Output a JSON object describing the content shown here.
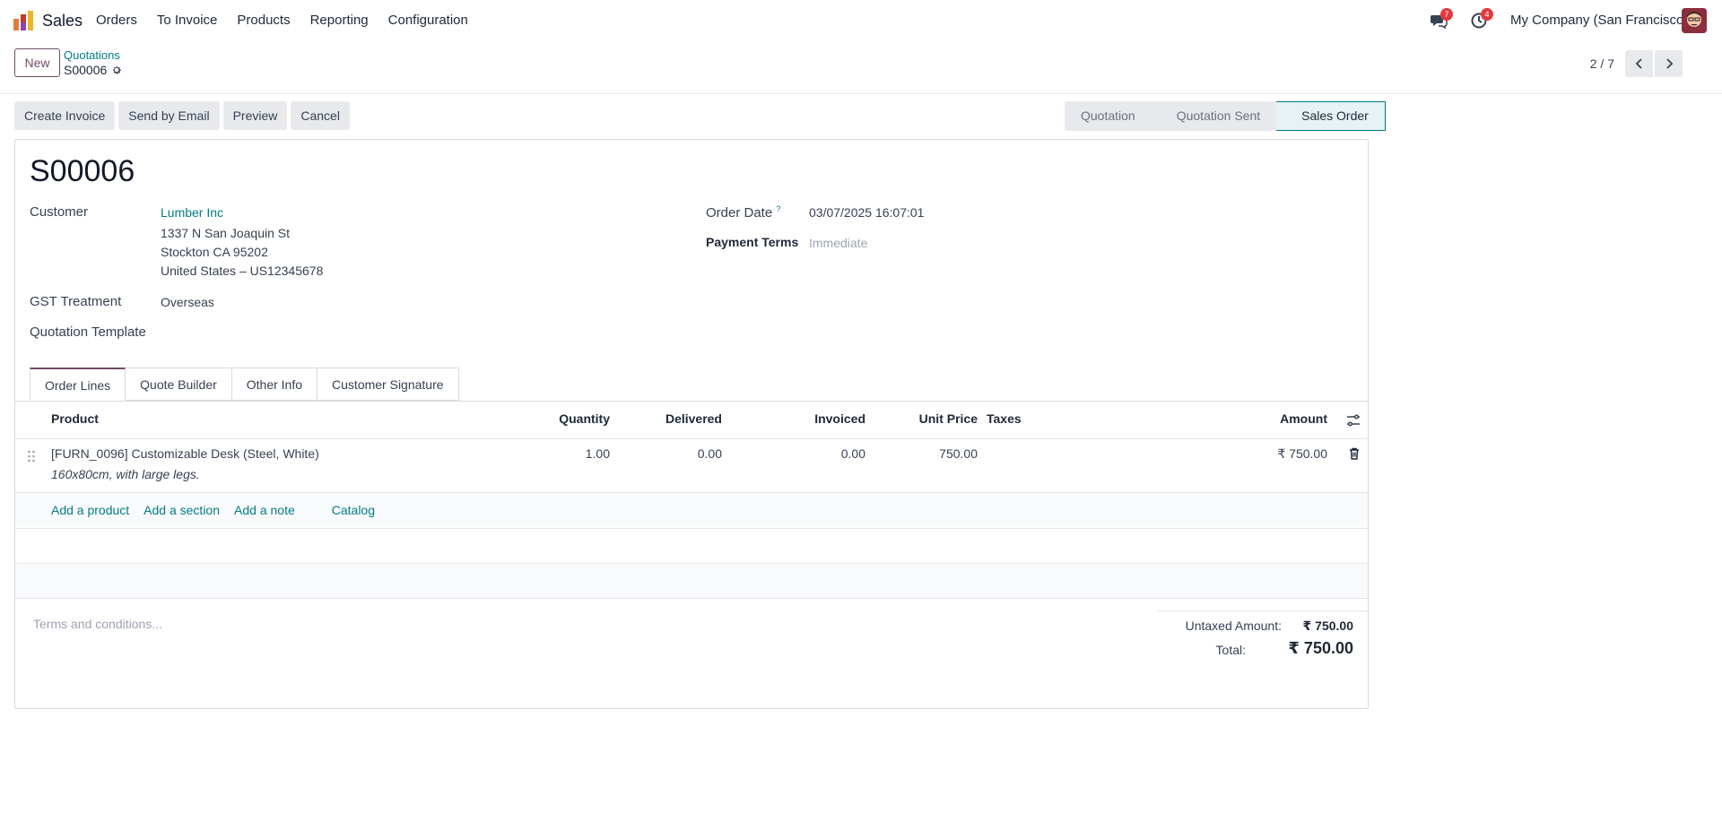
{
  "navbar": {
    "app_name": "Sales",
    "menu": [
      "Orders",
      "To Invoice",
      "Products",
      "Reporting",
      "Configuration"
    ],
    "messages_count": "7",
    "activities_count": "4",
    "company": "My Company (San Francisco)"
  },
  "control_panel": {
    "new_label": "New",
    "breadcrumb": "Quotations",
    "record_name": "S00006",
    "pager": "2 / 7"
  },
  "actions": [
    "Create Invoice",
    "Send by Email",
    "Preview",
    "Cancel"
  ],
  "status": {
    "stages": [
      "Quotation",
      "Quotation Sent",
      "Sales Order"
    ],
    "active": "Sales Order"
  },
  "form": {
    "title": "S00006",
    "customer_label": "Customer",
    "customer_name": "Lumber Inc",
    "address_line1": "1337 N San Joaquin St",
    "address_line2": "Stockton CA 95202",
    "address_line3": "United States – US12345678",
    "gst_label": "GST Treatment",
    "gst_value": "Overseas",
    "template_label": "Quotation Template",
    "order_date_label": "Order Date",
    "order_date_help": "?",
    "order_date_value": "03/07/2025 16:07:01",
    "payment_terms_label": "Payment Terms",
    "payment_terms_value": "Immediate"
  },
  "tabs": [
    "Order Lines",
    "Quote Builder",
    "Other Info",
    "Customer Signature"
  ],
  "table": {
    "headers": {
      "product": "Product",
      "quantity": "Quantity",
      "delivered": "Delivered",
      "invoiced": "Invoiced",
      "unit_price": "Unit Price",
      "taxes": "Taxes",
      "amount": "Amount"
    },
    "rows": [
      {
        "product": "[FURN_0096] Customizable Desk (Steel, White)",
        "description": "160x80cm, with large legs.",
        "quantity": "1.00",
        "delivered": "0.00",
        "invoiced": "0.00",
        "unit_price": "750.00",
        "taxes": "",
        "amount": "₹ 750.00"
      }
    ],
    "add_links": [
      "Add a product",
      "Add a section",
      "Add a note",
      "Catalog"
    ]
  },
  "footer": {
    "terms_placeholder": "Terms and conditions...",
    "untaxed_label": "Untaxed Amount:",
    "untaxed_value": "₹ 750.00",
    "total_label": "Total:",
    "total_value": "₹ 750.00"
  },
  "colors": {
    "brand": "#714b67",
    "link": "#017e84",
    "badge": "#e0393e"
  }
}
